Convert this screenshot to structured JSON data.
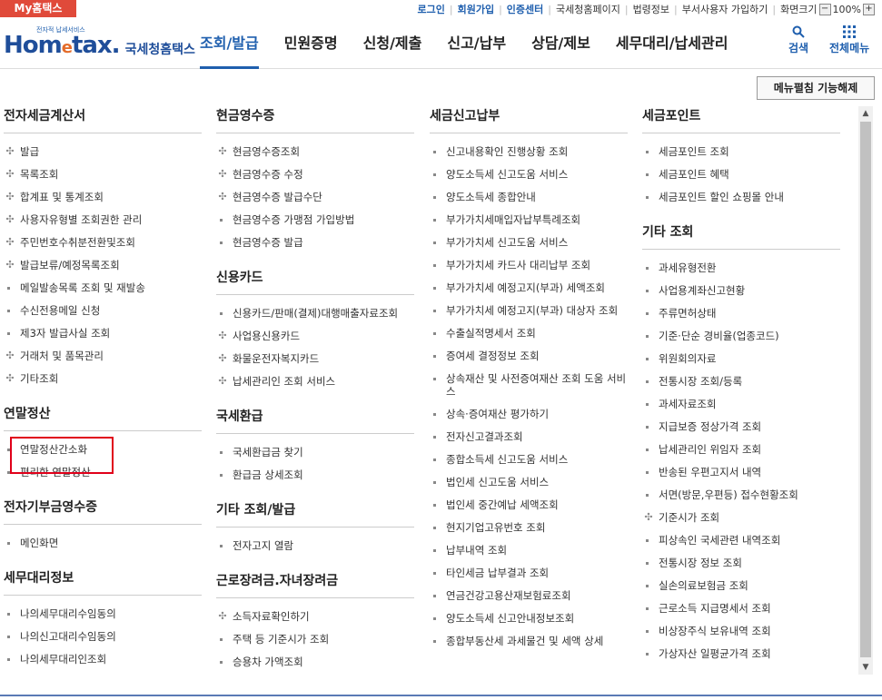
{
  "topbar": {
    "my_hometax": "My홈택스",
    "links": [
      "로그인",
      "회원가입",
      "인증센터",
      "국세청홈페이지",
      "법령정보",
      "부서사용자 가입하기",
      "화면크기"
    ],
    "zoom": "100%",
    "zoom_minus": "−",
    "zoom_plus": "+"
  },
  "header": {
    "logo_small": "전자적 납세서비스",
    "logo_home": "Hom",
    "logo_e": "e",
    "logo_tax": "tax.",
    "logo_sub": "국세청홈택스",
    "gnb": [
      "조회/발급",
      "민원증명",
      "신청/제출",
      "신고/납부",
      "상담/제보",
      "세무대리/납세관리"
    ],
    "search_label": "검색",
    "allmenu_label": "전체메뉴",
    "accent_color": "#1f5fae"
  },
  "fold_button": "메뉴펼침 기능해제",
  "columns": [
    {
      "sections": [
        {
          "title": "전자세금계산서",
          "items": [
            {
              "label": "발급",
              "marker": "plus"
            },
            {
              "label": "목록조회",
              "marker": "plus"
            },
            {
              "label": "합계표 및 통계조회",
              "marker": "plus"
            },
            {
              "label": "사용자유형별 조회권한 관리",
              "marker": "plus"
            },
            {
              "label": "주민번호수취분전환및조회",
              "marker": "plus"
            },
            {
              "label": "발급보류/예정목록조회",
              "marker": "plus"
            },
            {
              "label": "메일발송목록 조회 및 재발송",
              "marker": "dot"
            },
            {
              "label": "수신전용메일 신청",
              "marker": "dot"
            },
            {
              "label": "제3자 발급사실 조회",
              "marker": "dot"
            },
            {
              "label": "거래처 및 품목관리",
              "marker": "plus"
            },
            {
              "label": "기타조회",
              "marker": "plus"
            }
          ]
        },
        {
          "title": "연말정산",
          "items": [
            {
              "label": "연말정산간소화",
              "marker": "dot"
            },
            {
              "label": "편리한 연말정산",
              "marker": "dot"
            }
          ]
        },
        {
          "title": "전자기부금영수증",
          "items": [
            {
              "label": "메인화면",
              "marker": "dot"
            }
          ]
        },
        {
          "title": "세무대리정보",
          "items": [
            {
              "label": "나의세무대리수임동의",
              "marker": "dot"
            },
            {
              "label": "나의신고대리수임동의",
              "marker": "dot"
            },
            {
              "label": "나의세무대리인조회",
              "marker": "dot"
            }
          ]
        }
      ]
    },
    {
      "sections": [
        {
          "title": "현금영수증",
          "items": [
            {
              "label": "현금영수증조회",
              "marker": "plus"
            },
            {
              "label": "현금영수증 수정",
              "marker": "plus"
            },
            {
              "label": "현금영수증 발급수단",
              "marker": "plus"
            },
            {
              "label": "현금영수증 가맹점 가입방법",
              "marker": "dot"
            },
            {
              "label": "현금영수증 발급",
              "marker": "dot"
            }
          ]
        },
        {
          "title": "신용카드",
          "items": [
            {
              "label": "신용카드/판매(결제)대행매출자료조회",
              "marker": "dot"
            },
            {
              "label": "사업용신용카드",
              "marker": "plus"
            },
            {
              "label": "화물운전자복지카드",
              "marker": "plus"
            },
            {
              "label": "납세관리인 조회 서비스",
              "marker": "plus"
            }
          ]
        },
        {
          "title": "국세환급",
          "items": [
            {
              "label": "국세환급금 찾기",
              "marker": "dot"
            },
            {
              "label": "환급금 상세조회",
              "marker": "dot"
            }
          ]
        },
        {
          "title": "기타 조회/발급",
          "items": [
            {
              "label": "전자고지 열람",
              "marker": "dot"
            }
          ]
        },
        {
          "title": "근로장려금.자녀장려금",
          "items": [
            {
              "label": "소득자료확인하기",
              "marker": "plus"
            },
            {
              "label": "주택 등 기준시가 조회",
              "marker": "dot"
            },
            {
              "label": "승용차 가액조회",
              "marker": "dot"
            }
          ]
        }
      ]
    },
    {
      "sections": [
        {
          "title": "세금신고납부",
          "items": [
            {
              "label": "신고내용확인 진행상황 조회",
              "marker": "dot"
            },
            {
              "label": "양도소득세 신고도움 서비스",
              "marker": "dot"
            },
            {
              "label": "양도소득세 종합안내",
              "marker": "dot"
            },
            {
              "label": "부가가치세매입자납부특례조회",
              "marker": "dot"
            },
            {
              "label": "부가가치세 신고도움 서비스",
              "marker": "dot"
            },
            {
              "label": "부가가치세 카드사 대리납부 조회",
              "marker": "dot"
            },
            {
              "label": "부가가치세 예정고지(부과) 세액조회",
              "marker": "dot"
            },
            {
              "label": "부가가치세 예정고지(부과) 대상자 조회",
              "marker": "dot"
            },
            {
              "label": "수출실적명세서 조회",
              "marker": "dot"
            },
            {
              "label": "증여세 결정정보 조회",
              "marker": "dot"
            },
            {
              "label": "상속재산 및 사전증여재산 조회 도움 서비스",
              "marker": "dot"
            },
            {
              "label": "상속·증여재산 평가하기",
              "marker": "dot"
            },
            {
              "label": "전자신고결과조회",
              "marker": "dot"
            },
            {
              "label": "종합소득세 신고도움 서비스",
              "marker": "dot"
            },
            {
              "label": "법인세 신고도움 서비스",
              "marker": "dot"
            },
            {
              "label": "법인세 중간예납 세액조회",
              "marker": "dot"
            },
            {
              "label": "현지기업고유번호 조회",
              "marker": "dot"
            },
            {
              "label": "납부내역 조회",
              "marker": "dot"
            },
            {
              "label": "타인세금 납부결과 조회",
              "marker": "dot"
            },
            {
              "label": "연금건강고용산재보험료조회",
              "marker": "dot"
            },
            {
              "label": "양도소득세 신고안내정보조회",
              "marker": "dot"
            },
            {
              "label": "종합부동산세 과세물건 및 세액 상세",
              "marker": "dot"
            }
          ]
        }
      ]
    },
    {
      "sections": [
        {
          "title": "세금포인트",
          "items": [
            {
              "label": "세금포인트 조회",
              "marker": "dot"
            },
            {
              "label": "세금포인트 혜택",
              "marker": "dot"
            },
            {
              "label": "세금포인트 할인 쇼핑몰 안내",
              "marker": "dot"
            }
          ]
        },
        {
          "title": "기타 조회",
          "items": [
            {
              "label": "과세유형전환",
              "marker": "dot"
            },
            {
              "label": "사업용계좌신고현황",
              "marker": "dot"
            },
            {
              "label": "주류면허상태",
              "marker": "dot"
            },
            {
              "label": "기준·단순 경비율(업종코드)",
              "marker": "dot"
            },
            {
              "label": "위원회의자료",
              "marker": "dot"
            },
            {
              "label": "전통시장 조회/등록",
              "marker": "dot"
            },
            {
              "label": "과세자료조회",
              "marker": "dot"
            },
            {
              "label": "지급보증 정상가격 조회",
              "marker": "dot"
            },
            {
              "label": "납세관리인 위임자 조회",
              "marker": "dot"
            },
            {
              "label": "반송된 우편고지서 내역",
              "marker": "dot"
            },
            {
              "label": "서면(방문,우편등) 접수현황조회",
              "marker": "dot"
            },
            {
              "label": "기준시가 조회",
              "marker": "plus"
            },
            {
              "label": "피상속인 국세관련 내역조회",
              "marker": "dot"
            },
            {
              "label": "전통시장 정보 조회",
              "marker": "dot"
            },
            {
              "label": "실손의료보험금 조회",
              "marker": "dot"
            },
            {
              "label": "근로소득 지급명세서 조회",
              "marker": "dot"
            },
            {
              "label": "비상장주식 보유내역 조회",
              "marker": "dot"
            },
            {
              "label": "가상자산 일평균가격 조회",
              "marker": "dot"
            }
          ]
        }
      ]
    }
  ]
}
